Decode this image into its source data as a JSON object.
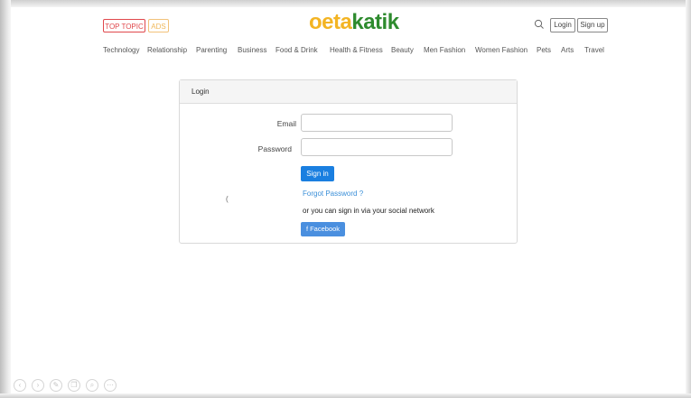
{
  "header": {
    "top_topic_label": "TOP TOPIC",
    "ads_label": "ADS",
    "logo_part1": "oeta",
    "logo_part2": "katik",
    "login_label": "Login",
    "signup_label": "Sign up",
    "search_icon": "search-icon"
  },
  "nav": {
    "items": [
      "Technology",
      "Relationship",
      "Parenting",
      "Business",
      "Food & Drink",
      "Health & Fitness",
      "Beauty",
      "Men Fashion",
      "Women Fashion",
      "Pets",
      "Arts",
      "Travel"
    ]
  },
  "login_panel": {
    "title": "Login",
    "email_label": "Email",
    "email_value": "",
    "password_label": "Password",
    "password_value": "",
    "signin_label": "Sign in",
    "forgot_label": "Forgot Password ?",
    "social_text": "or you can sign in via your social network",
    "facebook_label": "f Facebook",
    "stray_char": "("
  },
  "toolbar": {
    "icons": [
      "back-icon",
      "forward-icon",
      "pen-icon",
      "copy-icon",
      "zoom-icon",
      "more-icon"
    ]
  },
  "colors": {
    "top_topic": "#e0484c",
    "ads": "#f0b85a",
    "logo_orange": "#f3b423",
    "logo_green": "#2e8b2e",
    "primary": "#1a7fe0",
    "facebook": "#4a8fdf",
    "link": "#3a8fd8"
  }
}
